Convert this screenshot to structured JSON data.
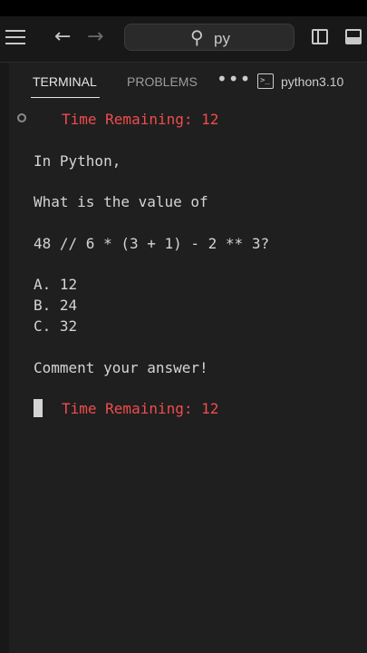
{
  "search": {
    "query": "py"
  },
  "panel": {
    "tabs": [
      {
        "label": "TERMINAL",
        "active": true
      },
      {
        "label": "PROBLEMS",
        "active": false
      }
    ],
    "more_icon": "ellipsis-icon",
    "terminal_profile": "python3.10",
    "dash": "-"
  },
  "terminal": {
    "timer_top": "Time Remaining: 12",
    "lines": [
      "In Python,",
      "What is the value of",
      "48 // 6 * (3 + 1) - 2 ** 3?",
      "A. 12",
      "B. 24",
      "C. 32",
      "Comment your answer!"
    ],
    "timer_bottom": "Time Remaining: 12"
  },
  "colors": {
    "background": "#1f1f1f",
    "text": "#d4d4d4",
    "timer": "#f14c4c"
  }
}
